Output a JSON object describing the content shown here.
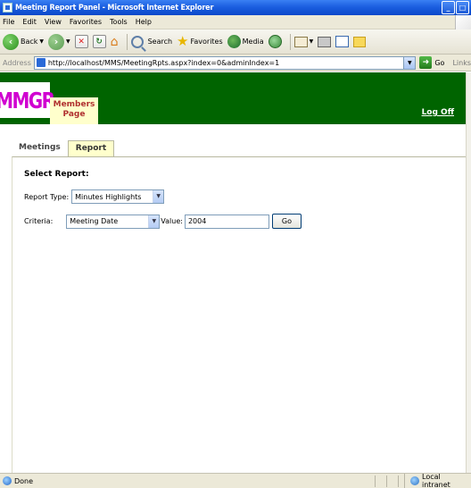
{
  "window": {
    "title": "Meeting Report Panel - Microsoft Internet Explorer",
    "minimize": "_",
    "maximize": "□"
  },
  "menu": [
    "File",
    "Edit",
    "View",
    "Favorites",
    "Tools",
    "Help"
  ],
  "toolbar": {
    "back": "Back",
    "search": "Search",
    "favorites": "Favorites",
    "media": "Media"
  },
  "address": {
    "label": "Address",
    "url": "http://localhost/MMS/MeetingRpts.aspx?index=0&adminIndex=1",
    "go": "Go",
    "links": "Links"
  },
  "header": {
    "logo": "MMGR",
    "members_page": "Members Page",
    "logoff": "Log Off"
  },
  "tabs": [
    {
      "label": "Meetings",
      "active": false
    },
    {
      "label": "Report",
      "active": true
    }
  ],
  "report": {
    "section_title": "Select Report:",
    "report_type_label": "Report Type:",
    "report_type_value": "Minutes Highlights",
    "criteria_label": "Criteria:",
    "criteria_value": "Meeting Date",
    "value_label": "Value:",
    "value_input": "2004",
    "go_button": "Go"
  },
  "status": {
    "text": "Done",
    "zone": "Local intranet"
  },
  "colors": {
    "header_bg": "#006400",
    "logo_text": "#d000d0",
    "members_bg": "#ffffcc",
    "members_text": "#b03030"
  }
}
